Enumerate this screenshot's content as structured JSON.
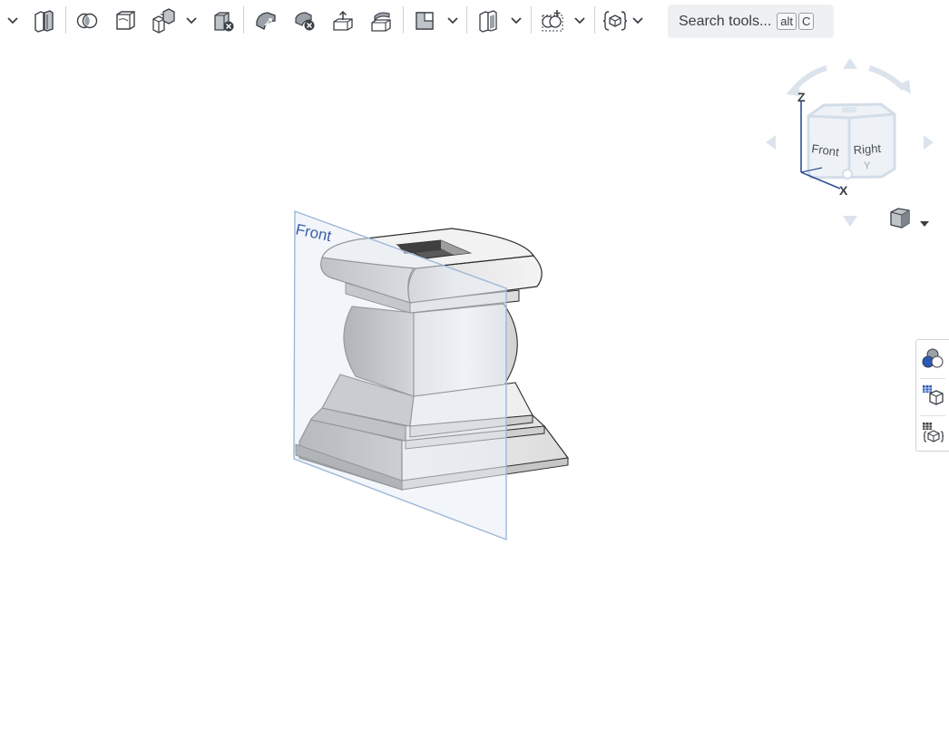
{
  "toolbar": {
    "tools": [
      {
        "name": "overflow-dropdown",
        "icon": "chevron-down-icon"
      },
      {
        "name": "split-part",
        "icon": "split-part-icon"
      },
      {
        "name": "boolean",
        "icon": "boolean-icon"
      },
      {
        "name": "offset-surface",
        "icon": "offset-surface-icon"
      },
      {
        "name": "transform",
        "icon": "transform-icon"
      },
      {
        "name": "delete-part",
        "icon": "delete-part-icon"
      },
      {
        "name": "modify-fillet",
        "icon": "modify-fillet-icon"
      },
      {
        "name": "delete-face",
        "icon": "delete-face-icon"
      },
      {
        "name": "move-face",
        "icon": "move-face-icon"
      },
      {
        "name": "replace-face",
        "icon": "replace-face-icon"
      },
      {
        "name": "plane",
        "icon": "plane-icon"
      },
      {
        "name": "mate-connector",
        "icon": "mate-connector-icon"
      },
      {
        "name": "pattern",
        "icon": "pattern-icon"
      },
      {
        "name": "custom-feature",
        "icon": "custom-feature-icon"
      }
    ],
    "search": {
      "label": "Search tools...",
      "shortcut_1": "alt",
      "shortcut_2": "C"
    }
  },
  "view_cube": {
    "front_label": "Front",
    "right_label": "Right",
    "axis_z": "Z",
    "axis_x": "X",
    "axis_y": "Y"
  },
  "viewport": {
    "plane_label": "Front"
  },
  "colors": {
    "plane_fill": "#e8eff6",
    "plane_edge": "#9db7d8",
    "accent_blue": "#3b5fa8",
    "icon_gray": "#3a3f45"
  }
}
